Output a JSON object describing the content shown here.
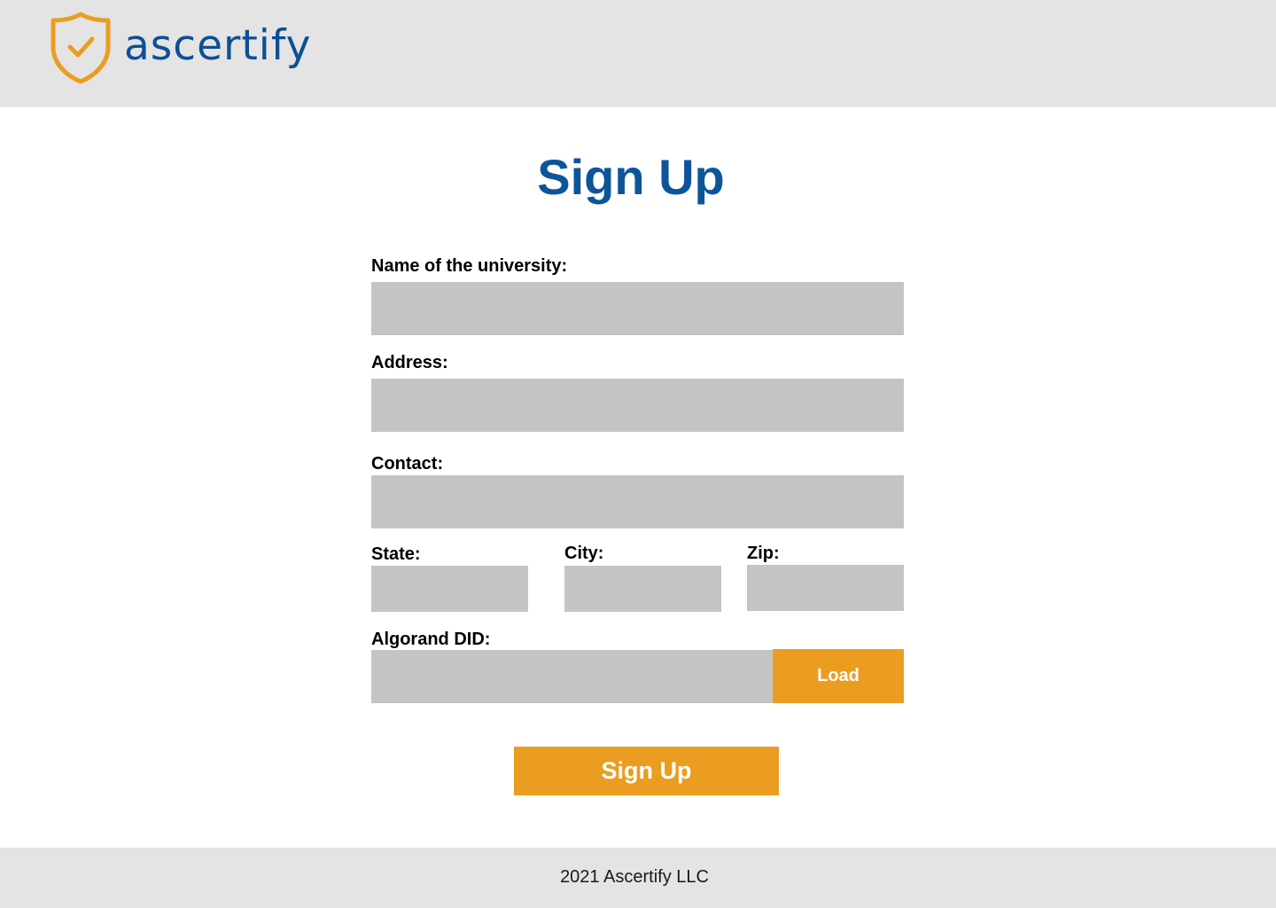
{
  "brand": {
    "name": "ascertify",
    "logo_icon": "shield-check-icon",
    "logo_color": "#eb9d21",
    "text_color": "#0d4f94"
  },
  "page": {
    "title": "Sign Up"
  },
  "form": {
    "university": {
      "label": "Name of the university:",
      "value": ""
    },
    "address": {
      "label": "Address:",
      "value": ""
    },
    "contact": {
      "label": "Contact:",
      "value": ""
    },
    "state": {
      "label": "State:",
      "value": ""
    },
    "city": {
      "label": "City:",
      "value": ""
    },
    "zip": {
      "label": "Zip:",
      "value": ""
    },
    "did": {
      "label": "Algorand DID:",
      "value": ""
    },
    "load_label": "Load",
    "submit_label": "Sign Up"
  },
  "footer": {
    "text": "2021 Ascertify LLC"
  },
  "colors": {
    "accent": "#eb9d21",
    "title": "#0d5599",
    "field_bg": "#c4c4c4",
    "bar_bg": "#e4e4e4"
  }
}
